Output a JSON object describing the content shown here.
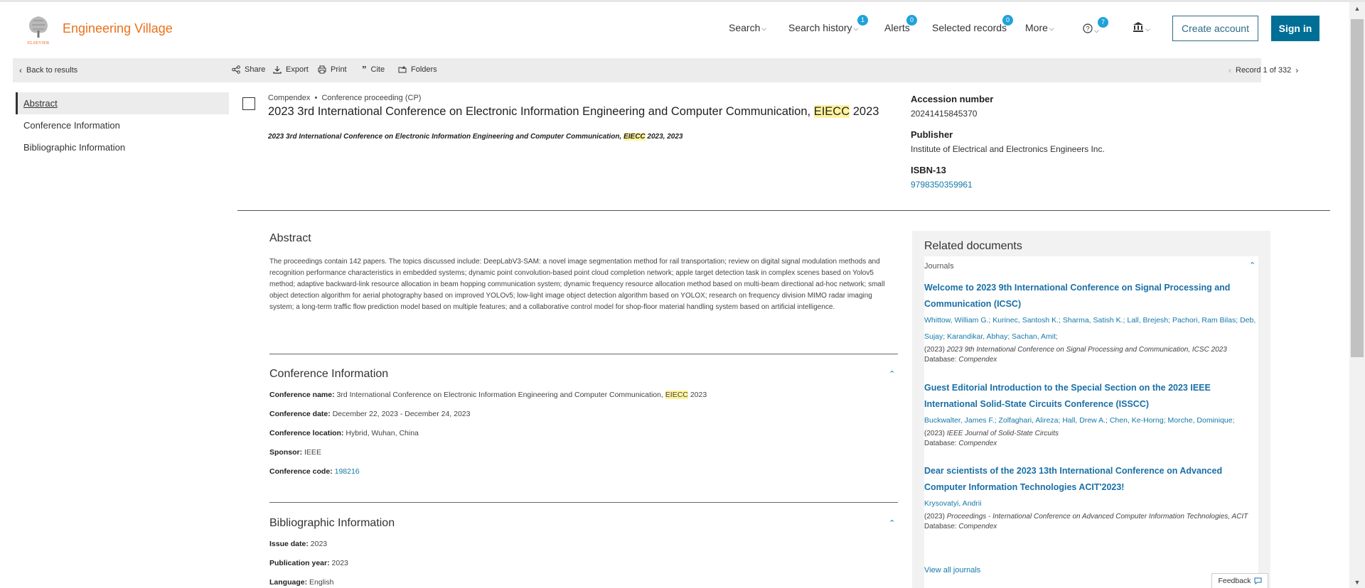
{
  "header": {
    "brand": "Engineering Village",
    "logo_text": "ELSEVIER",
    "nav": {
      "search": "Search",
      "search_history": "Search history",
      "search_history_badge": "1",
      "alerts": "Alerts",
      "alerts_badge": "0",
      "selected_records": "Selected records",
      "selected_records_badge": "0",
      "more": "More",
      "help_badge": "7"
    },
    "create_account": "Create account",
    "sign_in": "Sign in"
  },
  "toolbar": {
    "back": "Back to results",
    "share": "Share",
    "export": "Export",
    "print": "Print",
    "cite": "Cite",
    "folders": "Folders",
    "record_position": "Record 1 of 332"
  },
  "sidebar": {
    "items": [
      {
        "label": "Abstract"
      },
      {
        "label": "Conference Information"
      },
      {
        "label": "Bibliographic Information"
      }
    ]
  },
  "record": {
    "database": "Compendex",
    "bullet": "•",
    "doc_type": "Conference proceeding (CP)",
    "title_pre": "2023 3rd International Conference on Electronic Information Engineering and Computer Communication,",
    "title_hl": "EIECC",
    "title_post": "2023",
    "sub_pre": "2023 3rd International Conference on Electronic Information Engineering and Computer Communication,",
    "sub_hl": "EIECC",
    "sub_post": "2023, 2023"
  },
  "meta": {
    "accession_label": "Accession number",
    "accession_value": "20241415845370",
    "publisher_label": "Publisher",
    "publisher_value": "Institute of Electrical and Electronics Engineers Inc.",
    "isbn_label": "ISBN-13",
    "isbn_value": "9798350359961"
  },
  "abstract": {
    "heading": "Abstract",
    "text": "The proceedings contain 142 papers. The topics discussed include: DeepLabV3-SAM: a novel image segmentation method for rail transportation; review on digital signal modulation methods and recognition performance characteristics in embedded systems; dynamic point convolution-based point cloud completion network; apple target detection task in complex scenes based on Yolov5 method; adaptive backward-link resource allocation in beam hopping communication system; dynamic frequency resource allocation method based on multi-beam directional ad-hoc network; small object detection algorithm for aerial photography based on improved YOLOv5; low-light image object detection algorithm based on YOLOX; research on frequency division MIMO radar imaging system; a long-term traffic flow prediction model based on multiple features; and a collaborative control model for shop-floor material handling system based on artificial intelligence."
  },
  "conference": {
    "heading": "Conference Information",
    "name_label": "Conference name:",
    "name_pre": "3rd International Conference on Electronic Information Engineering and Computer Communication,",
    "name_hl": "EIECC",
    "name_post": "2023",
    "date_label": "Conference date:",
    "date_value": "December 22, 2023 - December 24, 2023",
    "location_label": "Conference location:",
    "location_value": "Hybrid, Wuhan, China",
    "sponsor_label": "Sponsor:",
    "sponsor_value": "IEEE",
    "code_label": "Conference code:",
    "code_value": "198216"
  },
  "bibliographic": {
    "heading": "Bibliographic Information",
    "issue_label": "Issue date:",
    "issue_value": "2023",
    "pubyear_label": "Publication year:",
    "pubyear_value": "2023",
    "language_label": "Language:",
    "language_value": "English"
  },
  "related": {
    "heading": "Related documents",
    "journals_label": "Journals",
    "docs": [
      {
        "title": "Welcome to 2023 9th International Conference on Signal Processing and Communication (ICSC)",
        "authors": "Whittow, William G.; Kurinec, Santosh K.; Sharma, Satish K.; Lall, Brejesh; Pachori, Ram Bilas; Deb, Sujay; Karandikar, Abhay; Sachan, Amit;",
        "year": "(2023)",
        "pub": "2023 9th International Conference on Signal Processing and Communication, ICSC 2023",
        "db_label": "Database:",
        "db": "Compendex"
      },
      {
        "title": "Guest Editorial Introduction to the Special Section on the 2023 IEEE International Solid-State Circuits Conference (ISSCC)",
        "authors": "Buckwalter, James F.; Zolfaghari, Alireza; Hall, Drew A.; Chen, Ke-Horng; Morche, Dominique;",
        "year": "(2023)",
        "pub": "IEEE Journal of Solid-State Circuits",
        "db_label": "Database:",
        "db": "Compendex"
      },
      {
        "title": "Dear scientists of the 2023 13th International Conference on Advanced Computer Information Technologies ACIT'2023!",
        "authors": "Krysovatyi, Andrii",
        "year": "(2023)",
        "pub": "Proceedings - International Conference on Advanced Computer Information Technologies, ACIT",
        "db_label": "Database:",
        "db": "Compendex"
      }
    ],
    "view_all": "View all journals"
  },
  "feedback": "Feedback",
  "colors": {
    "brand_orange": "#e9711c",
    "primary_blue": "#006f96",
    "link_blue": "#1579a8",
    "highlight": "#fff39d",
    "badge": "#1fa2d8"
  }
}
